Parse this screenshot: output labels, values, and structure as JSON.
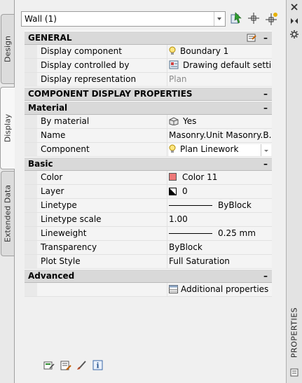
{
  "vtabs": [
    "Design",
    "Display",
    "Extended Data"
  ],
  "selector": {
    "value": "Wall (1)"
  },
  "right_strip": {
    "label": "PROPERTIES"
  },
  "sections": {
    "general": {
      "title": "GENERAL",
      "rows": [
        {
          "label": "Display component",
          "value": "Boundary 1",
          "icon": "lightbulb-icon"
        },
        {
          "label": "Display controlled by",
          "value": "Drawing default setti...",
          "icon": "display-settings-icon"
        },
        {
          "label": "Display representation",
          "value": "Plan"
        }
      ]
    },
    "component_display": {
      "title": "COMPONENT DISPLAY PROPERTIES"
    },
    "material": {
      "title": "Material",
      "rows": [
        {
          "label": "By material",
          "value": "Yes",
          "icon": "material-cube-icon"
        },
        {
          "label": "Name",
          "value": "Masonry.Unit  Masonry.B..."
        },
        {
          "label": "Component",
          "value": "Plan Linework",
          "icon": "lightbulb-icon"
        }
      ]
    },
    "basic": {
      "title": "Basic",
      "rows": [
        {
          "label": "Color",
          "value": "Color 11",
          "color": "#ee7878"
        },
        {
          "label": "Layer",
          "value": "0",
          "icon": "layer-icon"
        },
        {
          "label": "Linetype",
          "value": "ByBlock"
        },
        {
          "label": "Linetype scale",
          "value": "1.00"
        },
        {
          "label": "Lineweight",
          "value": "0.25 mm"
        },
        {
          "label": "Transparency",
          "value": "ByBlock"
        },
        {
          "label": "Plot Style",
          "value": "Full Saturation"
        }
      ]
    },
    "advanced": {
      "title": "Advanced",
      "rows": [
        {
          "label": "",
          "value": "Additional properties",
          "icon": "table-icon"
        }
      ]
    }
  }
}
